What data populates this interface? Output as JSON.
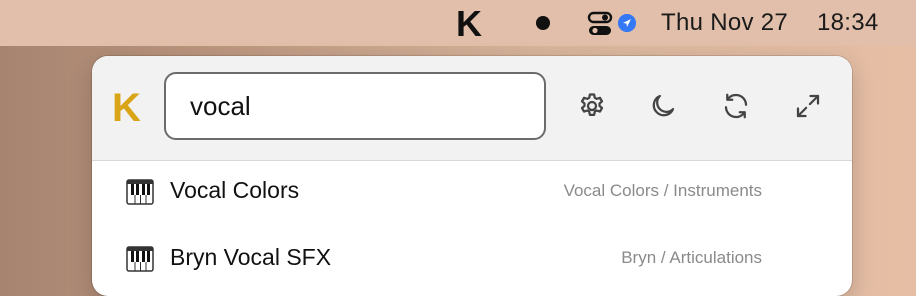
{
  "menubar": {
    "app_letter": "K",
    "date": "Thu Nov 27",
    "time": "18:34"
  },
  "panel": {
    "logo": "K",
    "search": {
      "value": "vocal",
      "placeholder": ""
    },
    "header_buttons": [
      {
        "icon": "gear-icon"
      },
      {
        "icon": "moon-icon"
      },
      {
        "icon": "refresh-icon"
      },
      {
        "icon": "expand-icon"
      }
    ],
    "results": [
      {
        "icon": "piano-icon",
        "name": "Vocal Colors",
        "path": "Vocal Colors / Instruments"
      },
      {
        "icon": "piano-icon",
        "name": "Bryn Vocal SFX",
        "path": "Bryn / Articulations"
      }
    ]
  },
  "colors": {
    "logo_accent": "#d9a416",
    "location_badge": "#3478f6"
  }
}
